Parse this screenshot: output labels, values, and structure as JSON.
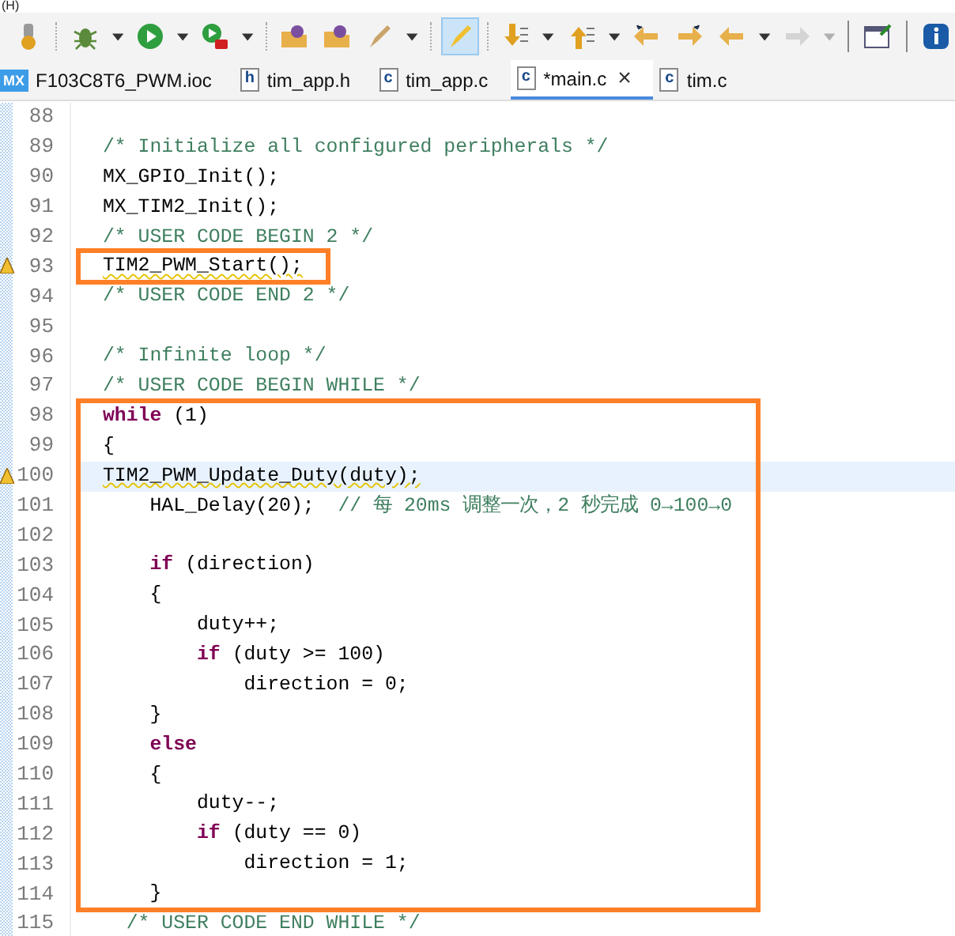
{
  "menu_fragment": "(H)",
  "toolbar": [
    {
      "kind": "build"
    },
    {
      "kind": "separator"
    },
    {
      "kind": "debug"
    },
    {
      "kind": "dropdown"
    },
    {
      "kind": "run"
    },
    {
      "kind": "dropdown"
    },
    {
      "kind": "external"
    },
    {
      "kind": "dropdown"
    },
    {
      "kind": "separator"
    },
    {
      "kind": "open-folder"
    },
    {
      "kind": "open-folder"
    },
    {
      "kind": "brush"
    },
    {
      "kind": "dropdown"
    },
    {
      "kind": "separator"
    },
    {
      "kind": "brush-toggle",
      "selected": true
    },
    {
      "kind": "separator"
    },
    {
      "kind": "arrow-down"
    },
    {
      "kind": "dropdown"
    },
    {
      "kind": "arrow-up"
    },
    {
      "kind": "dropdown"
    },
    {
      "kind": "back-star"
    },
    {
      "kind": "forward-star"
    },
    {
      "kind": "back"
    },
    {
      "kind": "dropdown"
    },
    {
      "kind": "forward",
      "disabled": true
    },
    {
      "kind": "dropdown",
      "disabled": true
    },
    {
      "kind": "bar"
    },
    {
      "kind": "window"
    },
    {
      "kind": "bar"
    },
    {
      "kind": "info"
    }
  ],
  "tabs": [
    {
      "label": "F103C8T6_PWM.ioc",
      "icon_text": "MX",
      "kind": "mx",
      "selected": false
    },
    {
      "label": "tim_app.h",
      "icon_text": "h",
      "kind": "file",
      "selected": false
    },
    {
      "label": "tim_app.c",
      "icon_text": "c",
      "kind": "file",
      "selected": false
    },
    {
      "label": "*main.c",
      "icon_text": "c",
      "kind": "file",
      "selected": true,
      "close_glyph": "×"
    },
    {
      "label": "tim.c",
      "icon_text": "c",
      "kind": "file",
      "selected": false
    }
  ],
  "blocks": [
    {
      "boxed": false,
      "lines": [
        {
          "number": "88",
          "warning": false,
          "highlighted": false
        },
        {
          "number": "89",
          "segments": [
            {
              "kind": "comment",
              "text": "/* Initialize all configured peripherals */"
            }
          ],
          "warning": false,
          "highlighted": false
        },
        {
          "number": "90",
          "segments": [
            {
              "kind": "plain",
              "text": "MX_GPIO_Init();"
            }
          ],
          "warning": false,
          "highlighted": false
        },
        {
          "number": "91",
          "segments": [
            {
              "kind": "plain",
              "text": "MX_TIM2_Init();"
            }
          ],
          "warning": false,
          "highlighted": false
        },
        {
          "number": "92",
          "segments": [
            {
              "kind": "comment",
              "text": "/* USER CODE BEGIN 2 */"
            }
          ],
          "warning": false,
          "highlighted": false
        }
      ]
    },
    {
      "boxed": true,
      "lines": [
        {
          "number": "93",
          "segments": [
            {
              "kind": "plain",
              "text": "TIM2_PWM_Start();"
            }
          ],
          "warning": true,
          "highlighted": false
        }
      ]
    },
    {
      "boxed": false,
      "lines": [
        {
          "number": "94",
          "segments": [
            {
              "kind": "comment",
              "text": "/* USER CODE END 2 */"
            }
          ],
          "warning": false,
          "highlighted": false
        },
        {
          "number": "95",
          "warning": false,
          "highlighted": false
        },
        {
          "number": "96",
          "segments": [
            {
              "kind": "comment",
              "text": "/* Infinite loop */"
            }
          ],
          "warning": false,
          "highlighted": false
        },
        {
          "number": "97",
          "segments": [
            {
              "kind": "comment",
              "text": "/* USER CODE BEGIN WHILE */"
            }
          ],
          "warning": false,
          "highlighted": false
        }
      ]
    },
    {
      "boxed": true,
      "lines": [
        {
          "number": "98",
          "segments": [
            {
              "kind": "keyword",
              "text": "while"
            },
            {
              "kind": "plain",
              "text": " (1)"
            }
          ],
          "warning": false,
          "highlighted": false
        },
        {
          "number": "99",
          "segments": [
            {
              "kind": "plain",
              "text": "{"
            }
          ],
          "warning": false,
          "highlighted": false
        },
        {
          "number": "100",
          "segments": [
            {
              "kind": "plain",
              "text": "TIM2_PWM_Update_Duty(duty);"
            }
          ],
          "warning": true,
          "highlighted": true
        },
        {
          "number": "101",
          "segments": [
            {
              "kind": "plain",
              "text": "    HAL_Delay(20);  "
            },
            {
              "kind": "comment",
              "text": "// 每 20ms 调整一次，2 秒完成 0→100→0"
            }
          ],
          "warning": false,
          "highlighted": false
        },
        {
          "number": "102",
          "warning": false,
          "highlighted": false
        },
        {
          "number": "103",
          "segments": [
            {
              "kind": "keyword",
              "text": "    if"
            },
            {
              "kind": "plain",
              "text": " (direction)"
            }
          ],
          "warning": false,
          "highlighted": false
        },
        {
          "number": "104",
          "segments": [
            {
              "kind": "plain",
              "text": "    {"
            }
          ],
          "warning": false,
          "highlighted": false
        },
        {
          "number": "105",
          "segments": [
            {
              "kind": "plain",
              "text": "        duty++;"
            }
          ],
          "warning": false,
          "highlighted": false
        },
        {
          "number": "106",
          "segments": [
            {
              "kind": "keyword",
              "text": "        if"
            },
            {
              "kind": "plain",
              "text": " (duty >= 100)"
            }
          ],
          "warning": false,
          "highlighted": false
        },
        {
          "number": "107",
          "segments": [
            {
              "kind": "plain",
              "text": "            direction = 0;"
            }
          ],
          "warning": false,
          "highlighted": false
        },
        {
          "number": "108",
          "segments": [
            {
              "kind": "plain",
              "text": "    }"
            }
          ],
          "warning": false,
          "highlighted": false
        },
        {
          "number": "109",
          "segments": [
            {
              "kind": "keyword",
              "text": "    else"
            }
          ],
          "warning": false,
          "highlighted": false
        },
        {
          "number": "110",
          "segments": [
            {
              "kind": "plain",
              "text": "    {"
            }
          ],
          "warning": false,
          "highlighted": false
        },
        {
          "number": "111",
          "segments": [
            {
              "kind": "plain",
              "text": "        duty--;"
            }
          ],
          "warning": false,
          "highlighted": false
        },
        {
          "number": "112",
          "segments": [
            {
              "kind": "keyword",
              "text": "        if"
            },
            {
              "kind": "plain",
              "text": " (duty == 0)"
            }
          ],
          "warning": false,
          "highlighted": false
        },
        {
          "number": "113",
          "segments": [
            {
              "kind": "plain",
              "text": "            direction = 1;"
            }
          ],
          "warning": false,
          "highlighted": false
        },
        {
          "number": "114",
          "segments": [
            {
              "kind": "plain",
              "text": "    }"
            }
          ],
          "warning": false,
          "highlighted": false
        }
      ]
    },
    {
      "boxed": false,
      "lines": [
        {
          "number": "115",
          "segments": [
            {
              "kind": "comment",
              "text": "  /* USER CODE END WHILE */"
            }
          ],
          "warning": false,
          "highlighted": false
        }
      ]
    }
  ]
}
